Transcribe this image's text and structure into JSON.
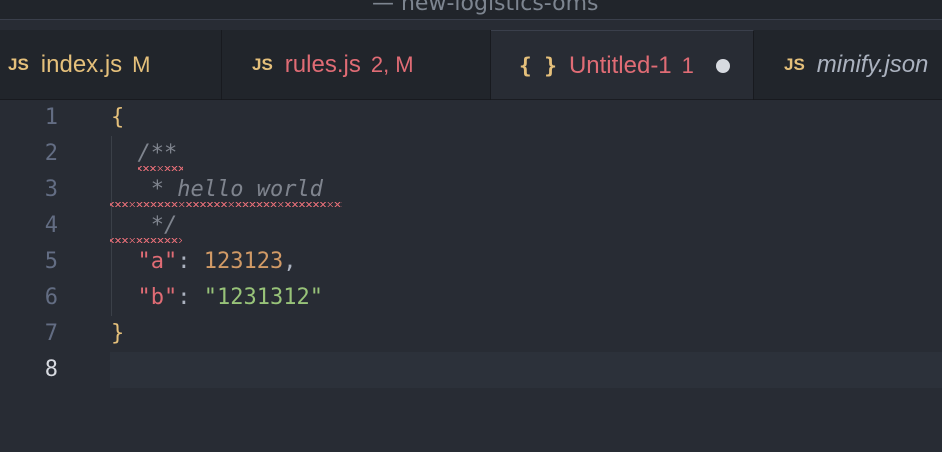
{
  "window": {
    "title": "— new-logistics-oms"
  },
  "tabs": [
    {
      "icon": "JS",
      "name": "index.js",
      "status": "M",
      "name_color": "#e5c07b",
      "status_color": "#e5c07b",
      "active": false,
      "italic": false
    },
    {
      "icon": "JS",
      "name": "rules.js",
      "status": "2, M",
      "name_color": "#e06c75",
      "status_color": "#e06c75",
      "active": false,
      "italic": false
    },
    {
      "icon": "{ }",
      "name": "Untitled-1",
      "status": "1",
      "name_color": "#e06c75",
      "status_color": "#e06c75",
      "active": true,
      "italic": false,
      "dirty": true
    },
    {
      "icon": "JS",
      "name": "minify.json",
      "status": "",
      "name_color": "#abb2bf",
      "status_color": "#abb2bf",
      "active": false,
      "italic": true
    }
  ],
  "editor": {
    "current_line": 8,
    "line_numbers": [
      "1",
      "2",
      "3",
      "4",
      "5",
      "6",
      "7",
      "8"
    ],
    "lines": {
      "l1": {
        "brace": "{"
      },
      "l2": {
        "comment": "/**"
      },
      "l3": {
        "comment": " * hello world"
      },
      "l4": {
        "comment": " */"
      },
      "l5": {
        "key": "\"a\"",
        "colon": ": ",
        "value": "123123",
        "comma": ","
      },
      "l6": {
        "key": "\"b\"",
        "colon": ": ",
        "value": "\"1231312\""
      },
      "l7": {
        "brace": "}"
      }
    }
  },
  "colors": {
    "background": "#282c34",
    "tabbar": "#21252b",
    "error_squiggle": "#e06c75"
  }
}
